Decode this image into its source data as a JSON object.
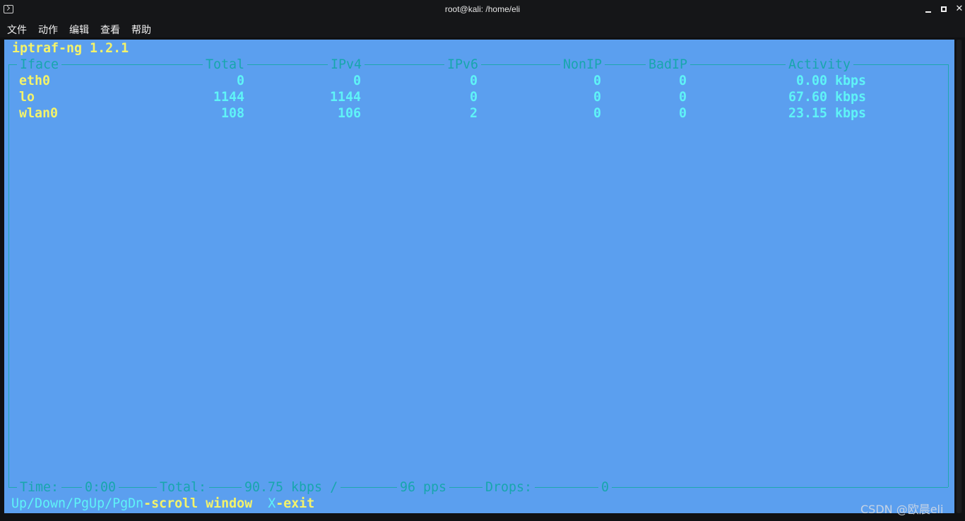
{
  "window": {
    "title": "root@kali: /home/eli"
  },
  "menu": [
    "文件",
    "动作",
    "编辑",
    "查看",
    "帮助"
  ],
  "program": {
    "name": "iptraf-ng 1.2.1"
  },
  "table": {
    "headers": [
      "Iface",
      "Total",
      "IPv4",
      "IPv6",
      "NonIP",
      "BadIP",
      "Activity"
    ],
    "rows": [
      {
        "iface": "eth0",
        "total": "0",
        "ipv4": "0",
        "ipv6": "0",
        "nonip": "0",
        "badip": "0",
        "activity": "0.00 kbps"
      },
      {
        "iface": "lo",
        "total": "1144",
        "ipv4": "1144",
        "ipv6": "0",
        "nonip": "0",
        "badip": "0",
        "activity": "67.60 kbps"
      },
      {
        "iface": "wlan0",
        "total": "108",
        "ipv4": "106",
        "ipv6": "2",
        "nonip": "0",
        "badip": "0",
        "activity": "23.15 kbps"
      }
    ]
  },
  "status": {
    "time_label": "Time:",
    "time_value": "0:00",
    "total_label": "Total:",
    "total_kbps": "90.75 kbps /",
    "total_pps": "96 pps",
    "drops_label": "Drops:",
    "drops_value": "0"
  },
  "keys": {
    "scroll_keys": "Up/Down/PgUp/PgDn",
    "scroll_desc": "-scroll window",
    "exit_key": "X",
    "exit_desc": "-exit"
  },
  "watermark": "CSDN @欧晨eli"
}
